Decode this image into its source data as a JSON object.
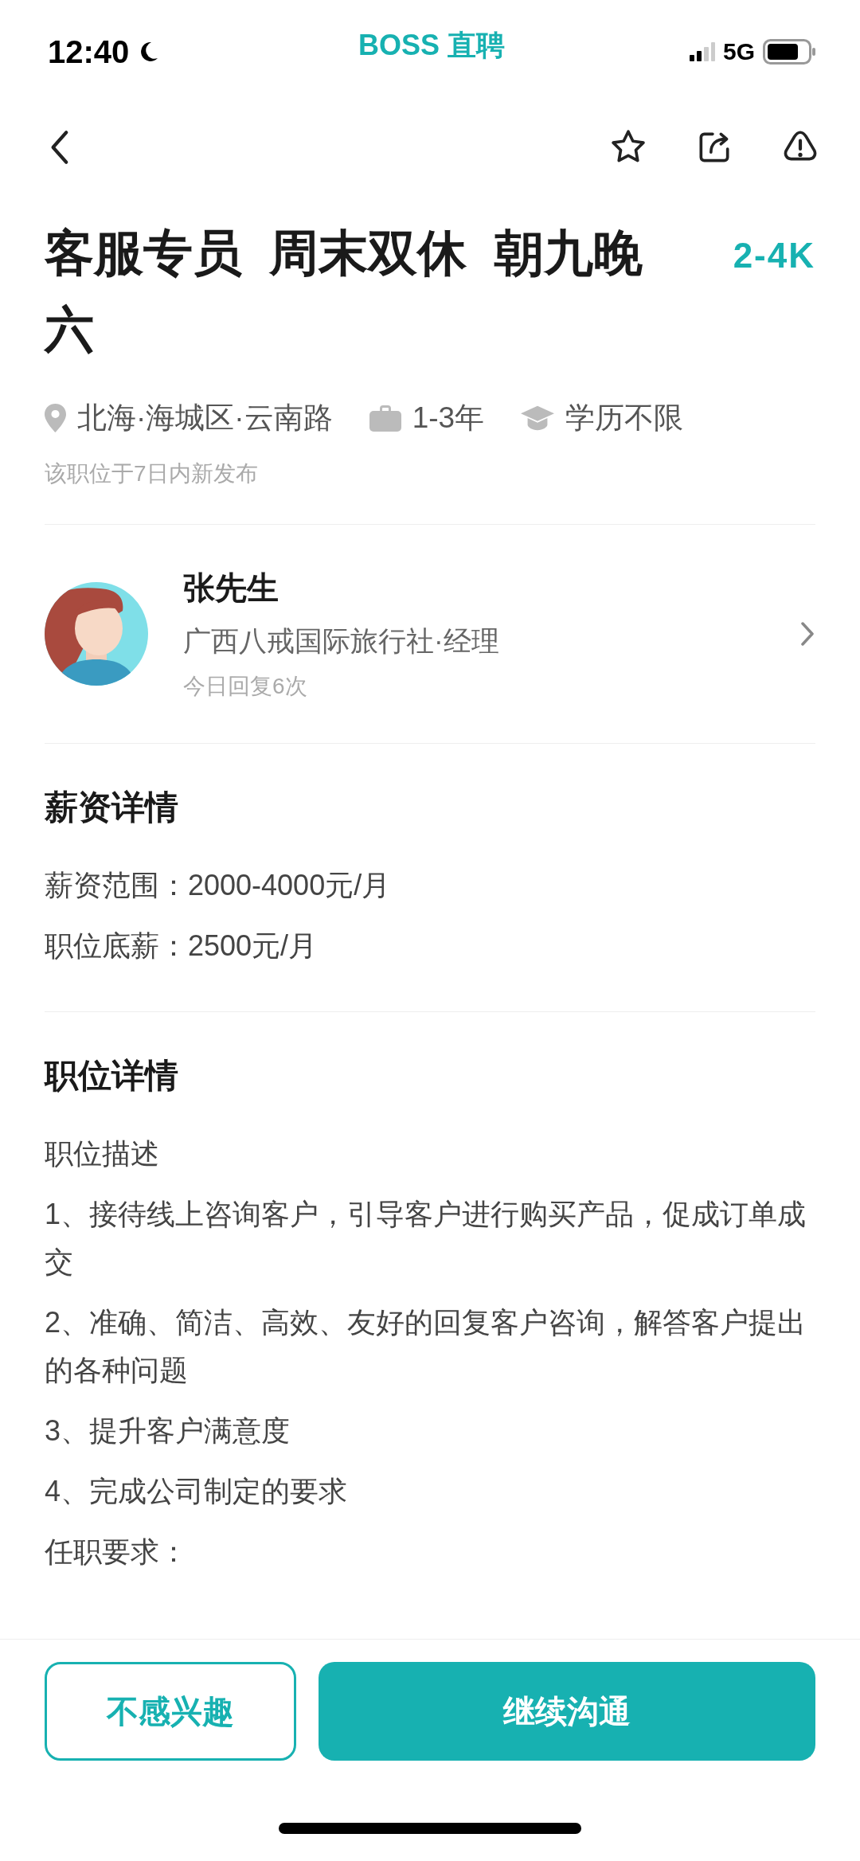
{
  "status_bar": {
    "time": "12:40",
    "app_name": "BOSS 直聘",
    "network": "5G"
  },
  "job": {
    "title": "客服专员  周末双休  朝九晚六",
    "salary": "2-4K",
    "location": "北海·海城区·云南路",
    "experience": "1-3年",
    "education": "学历不限",
    "posted": "该职位于7日内新发布"
  },
  "recruiter": {
    "name": "张先生",
    "company_position": "广西八戒国际旅行社·经理",
    "activity": "今日回复6次"
  },
  "sections": [
    {
      "title": "薪资详情",
      "lines": [
        "薪资范围：2000-4000元/月",
        "职位底薪：2500元/月"
      ]
    },
    {
      "title": "职位详情",
      "lines": [
        "职位描述",
        "1、接待线上咨询客户，引导客户进行购买产品，促成订单成交",
        "2、准确、简洁、高效、友好的回复客户咨询，解答客户提出的各种问题",
        "3、提升客户满意度",
        "4、完成公司制定的要求",
        "任职要求："
      ]
    }
  ],
  "buttons": [
    {
      "label": "不感兴趣",
      "kind": "outline"
    },
    {
      "label": "继续沟通",
      "kind": "primary"
    }
  ]
}
